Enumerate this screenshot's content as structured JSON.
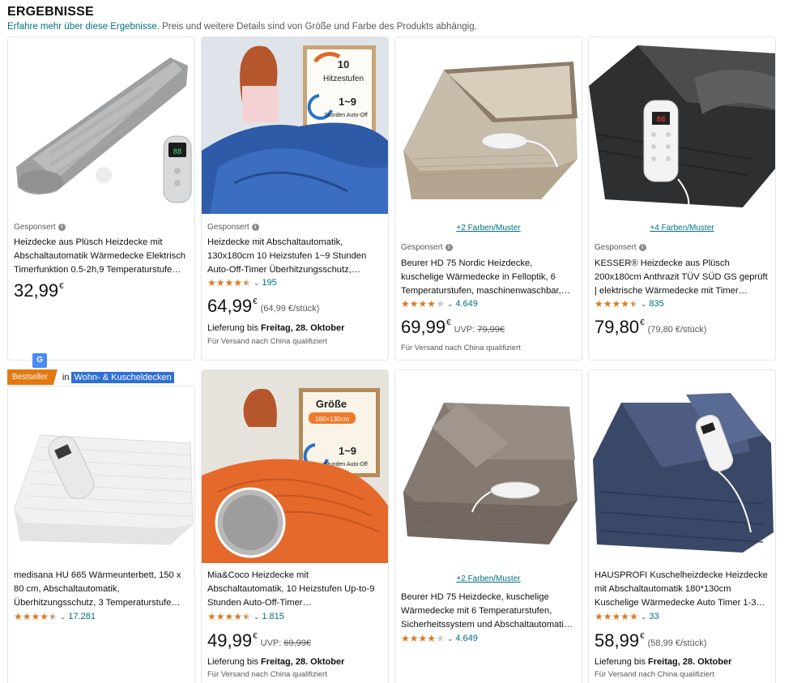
{
  "header": {
    "title": "ERGEBNISSE",
    "link_text": "Erfahre mehr über diese Ergebnisse.",
    "subtitle_rest": " Preis und weitere Details sind von Größe und Farbe des Produkts abhängig."
  },
  "badge": {
    "label": "Bestseller",
    "in_text": "in",
    "category": "Wohn- & Kuscheldecken"
  },
  "products": [
    {
      "sponsored": "Gesponsert",
      "title": "Heizdecke aus Plüsch Heizdecke mit Abschaltautomatik Wärmedecke Elektrisch Timerfunktion 0.5-2h,9 Temperaturstufe…",
      "price": "32,99",
      "currency": "€"
    },
    {
      "sponsored": "Gesponsert",
      "title": "Heizdecke mit Abschaltautomatik, 130x180cm 10 Heizstufen 1~9 Stunden Auto-Off-Timer Überhitzungsschutz,…",
      "rating": 4.5,
      "reviews": "195",
      "price": "64,99",
      "currency": "€",
      "unit_price": "(64,99 €/stück)",
      "delivery_prefix": "Lieferung bis ",
      "delivery_date": "Freitag, 28. Oktober",
      "shipping": "Für Versand nach China qualifiziert",
      "image_text": {
        "line1": "10",
        "line2": "Hitzestufen",
        "line3": "1~9",
        "line4": "Stunden Auto-Off"
      }
    },
    {
      "colors": "+2 Farben/Muster",
      "sponsored": "Gesponsert",
      "title": "Beurer HD 75 Nordic Heizdecke, kuschelige Wärmedecke in Felloptik, 6 Temperaturstufen, maschinenwaschbar,…",
      "rating": 4.0,
      "reviews": "4.649",
      "price": "69,99",
      "currency": "€",
      "uvp_label": "UVP:",
      "uvp_value": "79,99€",
      "shipping": "Für Versand nach China qualifiziert"
    },
    {
      "colors": "+4 Farben/Muster",
      "sponsored": "Gesponsert",
      "title": "KESSER® Heizdecke aus Plüsch 200x180cm Anthrazit TÜV SÜD GS geprüft | elektrische Wärmedecke mit Timer…",
      "rating": 4.5,
      "reviews": "835",
      "price": "79,80",
      "currency": "€",
      "unit_price": "(79,80 €/stück)"
    },
    {
      "title": "medisana HU 665 Wärmeunterbett, 150 x 80 cm, Abschaltautomatik, Überhitzungsschutz, 3 Temperaturstufe…",
      "rating": 4.5,
      "reviews": "17.281"
    },
    {
      "title": "Mia&Coco Heizdecke mit Abschaltautomatik, 10 Heizstufen Up-to-9 Stunden Auto-Off-Timer…",
      "rating": 4.5,
      "reviews": "1.815",
      "price": "49,99",
      "currency": "€",
      "uvp_label": "UVP:",
      "uvp_value": "69,99€",
      "delivery_prefix": "Lieferung bis ",
      "delivery_date": "Freitag, 28. Oktober",
      "shipping": "Für Versand nach China qualifiziert",
      "image_text": {
        "line1": "Größe",
        "line2": "160×130cm",
        "line3": "1~9",
        "line4": "Stunden Auto-Off"
      }
    },
    {
      "colors": "+2 Farben/Muster",
      "title": "Beurer HD 75 Heizdecke, kuschelige Wärmedecke mit 6 Temperaturstufen, Sicherheitssystem und Abschaltautomati…",
      "rating": 4.0,
      "reviews": "4.649"
    },
    {
      "title": "HAUSPROFI Kuschelheizdecke Heizdecke mit Abschaltautomatik 180*130cm Kuschelige Wärmedecke Auto Timer 1-3…",
      "rating": 5.0,
      "reviews": "33",
      "price": "58,99",
      "currency": "€",
      "unit_price": "(58,99 €/stück)",
      "delivery_prefix": "Lieferung bis ",
      "delivery_date": "Freitag, 28. Oktober",
      "shipping": "Für Versand nach China qualifiziert"
    }
  ]
}
